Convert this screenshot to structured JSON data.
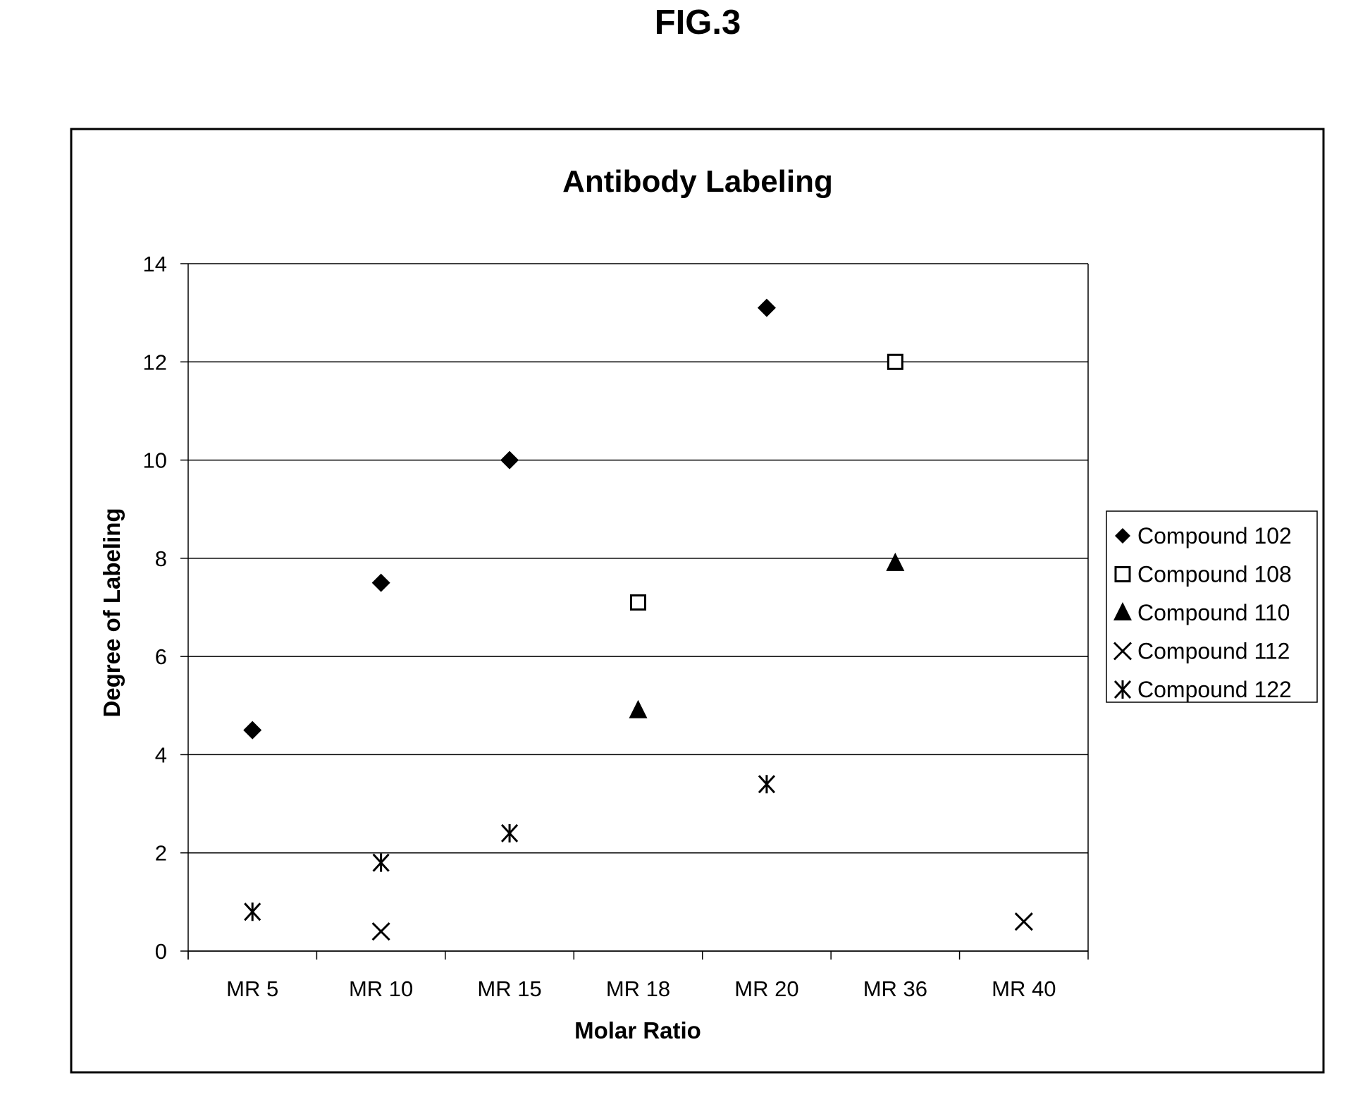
{
  "figure_label": "FIG.3",
  "chart_data": {
    "type": "scatter",
    "title": "Antibody Labeling",
    "xlabel": "Molar Ratio",
    "ylabel": "Degree of Labeling",
    "categories": [
      "MR 5",
      "MR 10",
      "MR 15",
      "MR 18",
      "MR 20",
      "MR 36",
      "MR 40"
    ],
    "ylim": [
      0,
      14
    ],
    "yticks": [
      0,
      2,
      4,
      6,
      8,
      10,
      12,
      14
    ],
    "grid": "horizontal",
    "legend_position": "right",
    "series": [
      {
        "name": "Compound 102",
        "marker": "diamond-filled",
        "values": [
          4.5,
          7.5,
          10.0,
          null,
          13.1,
          null,
          null
        ]
      },
      {
        "name": "Compound 108",
        "marker": "square-open",
        "values": [
          null,
          null,
          null,
          7.1,
          null,
          12.0,
          null
        ]
      },
      {
        "name": "Compound 110",
        "marker": "triangle-filled",
        "values": [
          null,
          null,
          null,
          4.9,
          null,
          7.9,
          null
        ]
      },
      {
        "name": "Compound 112",
        "marker": "x-cross",
        "values": [
          null,
          0.4,
          null,
          null,
          null,
          null,
          0.6
        ]
      },
      {
        "name": "Compound 122",
        "marker": "asterisk",
        "values": [
          0.8,
          1.8,
          2.4,
          null,
          3.4,
          null,
          null
        ]
      }
    ]
  }
}
